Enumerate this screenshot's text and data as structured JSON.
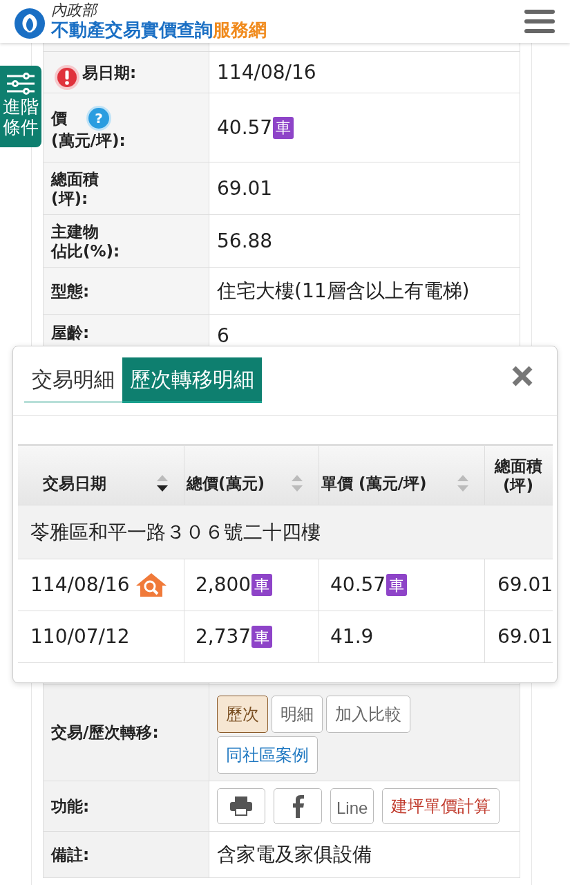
{
  "header": {
    "ministry": "內政部",
    "title": "不動產交易實價查詢",
    "title_accent": "服務網"
  },
  "filter_button": {
    "label_lines": [
      "進階",
      "條件"
    ],
    "alert": true
  },
  "detail_rows": [
    {
      "label_lines": [
        "易日期:"
      ],
      "value": "114/08/16"
    },
    {
      "label_lines": [
        "價",
        "(萬元/坪):"
      ],
      "value": "40.57",
      "badge": "車",
      "help": "?"
    },
    {
      "label_lines": [
        "總面積",
        "(坪):"
      ],
      "value": "69.01"
    },
    {
      "label_lines": [
        "主建物",
        "佔比(%):"
      ],
      "value": "56.88"
    },
    {
      "label_lines": [
        "型態:"
      ],
      "value": "住宅大樓(11層含以上有電梯)"
    },
    {
      "label_lines": [
        "屋齡:"
      ],
      "value": "6"
    }
  ],
  "modal": {
    "tabs": [
      {
        "label": "交易明細",
        "selected": false
      },
      {
        "label": "歷次轉移明細",
        "selected": true
      }
    ],
    "table": {
      "columns": [
        {
          "label_lines": [
            "交易日期"
          ],
          "sort_active": true
        },
        {
          "label_lines": [
            "總價(萬元)"
          ],
          "sort_active": false
        },
        {
          "label_lines": [
            "單價 (萬元/坪)"
          ],
          "sort_active": false
        },
        {
          "label_lines": [
            "總面積",
            "(坪)"
          ]
        }
      ],
      "group": "苓雅區和平一路３０６號二十四樓",
      "rows": [
        {
          "house_icon": true,
          "cells": [
            {
              "text": "114/08/16"
            },
            {
              "text": "2,800",
              "badge": "車"
            },
            {
              "text": "40.57",
              "badge": "車"
            },
            {
              "text": "69.01"
            }
          ]
        },
        {
          "house_icon": false,
          "cells": [
            {
              "text": "110/07/12"
            },
            {
              "text": "2,737",
              "badge": "車"
            },
            {
              "text": "41.9"
            },
            {
              "text": "69.01"
            }
          ]
        }
      ]
    }
  },
  "transfer_row": {
    "label": "交易/歷次轉移:",
    "buttons": [
      {
        "label": "歷次",
        "kind": "plain",
        "selected": true
      },
      {
        "label": "明細",
        "kind": "plain",
        "selected": false
      },
      {
        "label": "加入比較",
        "kind": "plain",
        "selected": false
      },
      {
        "label": "同社區案例",
        "kind": "link",
        "selected": false
      }
    ]
  },
  "function_row": {
    "label": "功能:",
    "buttons": [
      {
        "kind": "print"
      },
      {
        "kind": "facebook"
      },
      {
        "kind": "text",
        "label": "Line"
      },
      {
        "kind": "calc",
        "label": "建坪單價計算"
      }
    ]
  },
  "note_row": {
    "label": "備註:",
    "value": "含家電及家俱設備"
  }
}
